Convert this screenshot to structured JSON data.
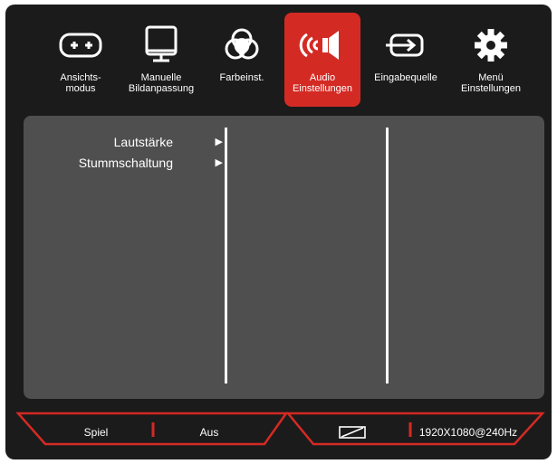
{
  "tabs": [
    {
      "label": "Ansichts-\nmodus",
      "icon": "gamepad-icon",
      "active": false
    },
    {
      "label": "Manuelle\nBildanpassung",
      "icon": "monitor-icon",
      "active": false
    },
    {
      "label": "Farbeinst.",
      "icon": "color-circles-icon",
      "active": false
    },
    {
      "label": "Audio\nEinstellungen",
      "icon": "speaker-icon",
      "active": true
    },
    {
      "label": "Eingabequelle",
      "icon": "input-source-icon",
      "active": false
    },
    {
      "label": "Menü\nEinstellungen",
      "icon": "gear-icon",
      "active": false
    }
  ],
  "menu": {
    "items": [
      {
        "label": "Lautstärke",
        "arrow": "▶"
      },
      {
        "label": "Stummschaltung",
        "arrow": "▶"
      }
    ]
  },
  "status": {
    "mode": "Spiel",
    "state": "Aus",
    "aspect_icon": "aspect-ratio-icon",
    "resolution": "1920X1080@240Hz"
  },
  "colors": {
    "accent": "#d42a24",
    "background": "#1b1b1b",
    "panel": "#4f4f4f",
    "text": "#ffffff"
  }
}
